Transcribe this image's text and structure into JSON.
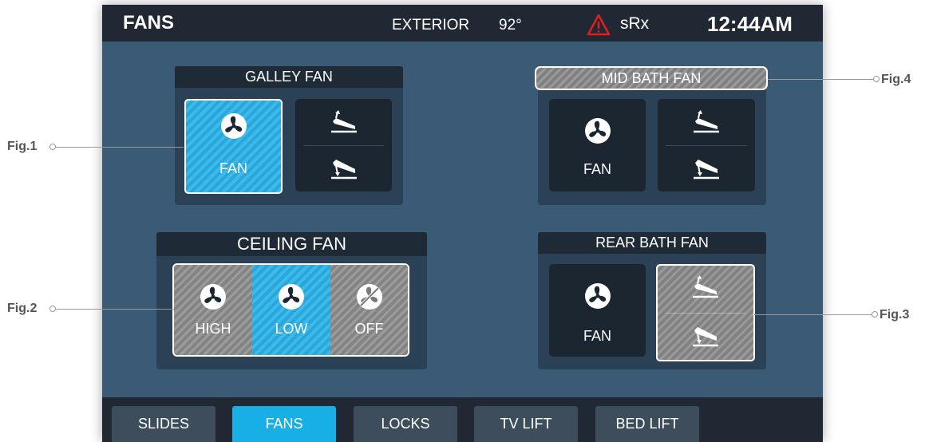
{
  "header": {
    "title": "FANS",
    "exterior_label": "EXTERIOR",
    "temperature": "92°",
    "alert_icon": "warning-triangle-icon",
    "srx": "sRx",
    "clock": "12:44AM"
  },
  "colors": {
    "active_blue": "#2aa6da",
    "panel_bg": "#3a5a76",
    "bar_bg": "#1f2833",
    "alert_red": "#e02020"
  },
  "panels": {
    "galley": {
      "title": "GALLEY FAN",
      "fan_label": "FAN",
      "fan_state": "on"
    },
    "mid_bath": {
      "title": "MID BATH FAN",
      "fan_label": "FAN",
      "fan_state": "off"
    },
    "ceiling": {
      "title": "CEILING FAN",
      "options": [
        "HIGH",
        "LOW",
        "OFF"
      ],
      "selected": "LOW"
    },
    "rear_bath": {
      "title": "REAR BATH FAN",
      "fan_label": "FAN",
      "fan_state": "off"
    }
  },
  "nav": {
    "tabs": [
      {
        "label": "SLIDES"
      },
      {
        "label": "FANS"
      },
      {
        "label": "LOCKS"
      },
      {
        "label": "TV LIFT"
      },
      {
        "label": "BED LIFT"
      }
    ],
    "active": "FANS"
  },
  "callouts": {
    "fig1": "Fig.1",
    "fig2": "Fig.2",
    "fig3": "Fig.3",
    "fig4": "Fig.4"
  }
}
